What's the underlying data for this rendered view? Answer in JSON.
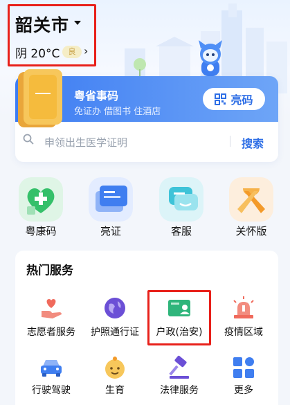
{
  "location": {
    "city": "韶关市",
    "weather": "阴 20°C",
    "aqi": "良"
  },
  "banner": {
    "title": "粤省事码",
    "subtitle": "免证办 借图书 住酒店",
    "tile_text": "一",
    "button_label": "亮码"
  },
  "search": {
    "placeholder": "申领出生医学证明",
    "button_label": "搜索"
  },
  "quick_actions": [
    {
      "label": "粤康码",
      "icon": "health-code-icon"
    },
    {
      "label": "亮证",
      "icon": "certificate-icon"
    },
    {
      "label": "客服",
      "icon": "chat-icon"
    },
    {
      "label": "关怀版",
      "icon": "ribbon-icon"
    }
  ],
  "hot_services": {
    "title": "热门服务",
    "items": [
      {
        "label": "志愿者服务",
        "icon": "volunteer-hand-heart-icon"
      },
      {
        "label": "护照通行证",
        "icon": "passport-icon"
      },
      {
        "label": "户政(治安)",
        "icon": "household-id-card-icon"
      },
      {
        "label": "疫情区域",
        "icon": "alarm-siren-icon"
      },
      {
        "label": "行驶驾驶",
        "icon": "car-icon"
      },
      {
        "label": "生育",
        "icon": "baby-face-icon"
      },
      {
        "label": "法律服务",
        "icon": "gavel-icon"
      },
      {
        "label": "更多",
        "icon": "grid-more-icon"
      }
    ]
  },
  "colors": {
    "accent": "#2f6fe6",
    "highlight_box": "#e8201a"
  }
}
